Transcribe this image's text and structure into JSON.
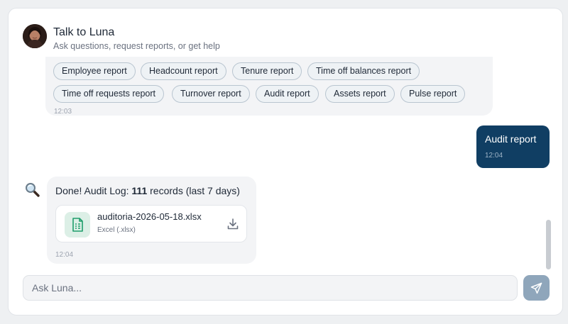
{
  "header": {
    "title": "Talk to Luna",
    "subtitle": "Ask questions, request reports, or get help"
  },
  "chips": [
    "Employee report",
    "Headcount report",
    "Tenure report",
    "Time off balances report",
    "Time off requests report",
    "Turnover report",
    "Audit report",
    "Assets report",
    "Pulse report"
  ],
  "chips_time": "12:03",
  "user_message": {
    "text": "Audit report",
    "time": "12:04"
  },
  "bot_reply": {
    "text_before": "Done! Audit Log: ",
    "count": "111",
    "text_after": " records (last 7 days)",
    "time": "12:04",
    "file": {
      "name": "auditoria-2026-05-18.xlsx",
      "type": "Excel (.xlsx)"
    }
  },
  "composer": {
    "placeholder": "Ask Luna..."
  },
  "colors": {
    "user_bubble": "#103e63",
    "send_button": "#8fa6bb",
    "file_icon": "#1f9d6b"
  },
  "icons": {
    "bot": "magnifying-glass-icon",
    "file": "spreadsheet-icon",
    "download": "download-icon",
    "send": "send-icon"
  }
}
